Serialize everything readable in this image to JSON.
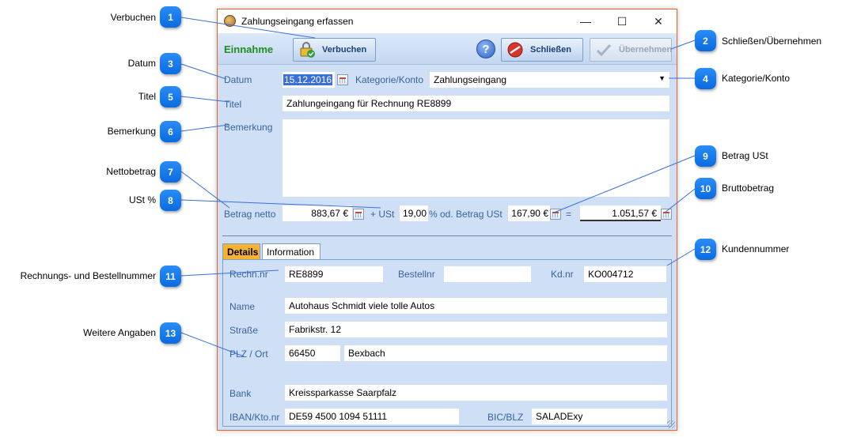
{
  "window": {
    "title": "Zahlungseingang erfassen",
    "minimize_glyph": "—",
    "maximize_glyph": "☐",
    "close_glyph": "✕"
  },
  "toolbar": {
    "mode_label": "Einnahme",
    "book_label": "Verbuchen",
    "help_glyph": "?",
    "close_label": "Schließen",
    "apply_label": "Übernehmen"
  },
  "form": {
    "datum_label": "Datum",
    "datum_value": "15.12.2016",
    "kategorie_label": "Kategorie/Konto",
    "kategorie_value": "Zahlungseingang",
    "kategorie_arrow": "▼",
    "titel_label": "Titel",
    "titel_value": "Zahlungeingang für Rechnung RE8899",
    "bemerkung_label": "Bemerkung",
    "bemerkung_value": "",
    "betrag_netto_label": "Betrag netto",
    "betrag_netto_value": "883,67 €",
    "ust_plus_label": "+ USt",
    "ust_percent_value": "19,00",
    "ust_betrag_label": "% od. Betrag USt",
    "ust_betrag_value": "167,90 €",
    "equals": "=",
    "brutto_value": "1.051,57 €"
  },
  "tabs": {
    "details": "Details",
    "information": "Information"
  },
  "details": {
    "rechn_label": "Rechn.nr",
    "rechn_value": "RE8899",
    "bestell_label": "Bestellnr",
    "bestell_value": "",
    "kd_label": "Kd.nr",
    "kd_value": "KO004712",
    "name_label": "Name",
    "name_value": "Autohaus Schmidt viele tolle Autos",
    "strasse_label": "Straße",
    "strasse_value": "Fabrikstr. 12",
    "plz_label": "PLZ / Ort",
    "plz_value": "66450",
    "ort_value": "Bexbach",
    "bank_label": "Bank",
    "bank_value": "Kreissparkasse Saarpfalz",
    "iban_label": "IBAN/Kto.nr",
    "iban_value": "DE59 4500 1094 51111",
    "bic_label": "BIC/BLZ",
    "bic_value": "SALADExy"
  },
  "callouts": [
    {
      "num": "1",
      "label": "Verbuchen"
    },
    {
      "num": "2",
      "label": "Schließen/Übernehmen"
    },
    {
      "num": "3",
      "label": "Datum"
    },
    {
      "num": "4",
      "label": "Kategorie/Konto"
    },
    {
      "num": "5",
      "label": "Titel"
    },
    {
      "num": "6",
      "label": "Bemerkung"
    },
    {
      "num": "7",
      "label": "Nettobetrag"
    },
    {
      "num": "8",
      "label": "USt %"
    },
    {
      "num": "9",
      "label": "Betrag USt"
    },
    {
      "num": "10",
      "label": "Bruttobetrag"
    },
    {
      "num": "11",
      "label": "Rechnungs- und Bestellnummer"
    },
    {
      "num": "12",
      "label": "Kundennummer"
    },
    {
      "num": "13",
      "label": "Weitere Angaben"
    }
  ]
}
